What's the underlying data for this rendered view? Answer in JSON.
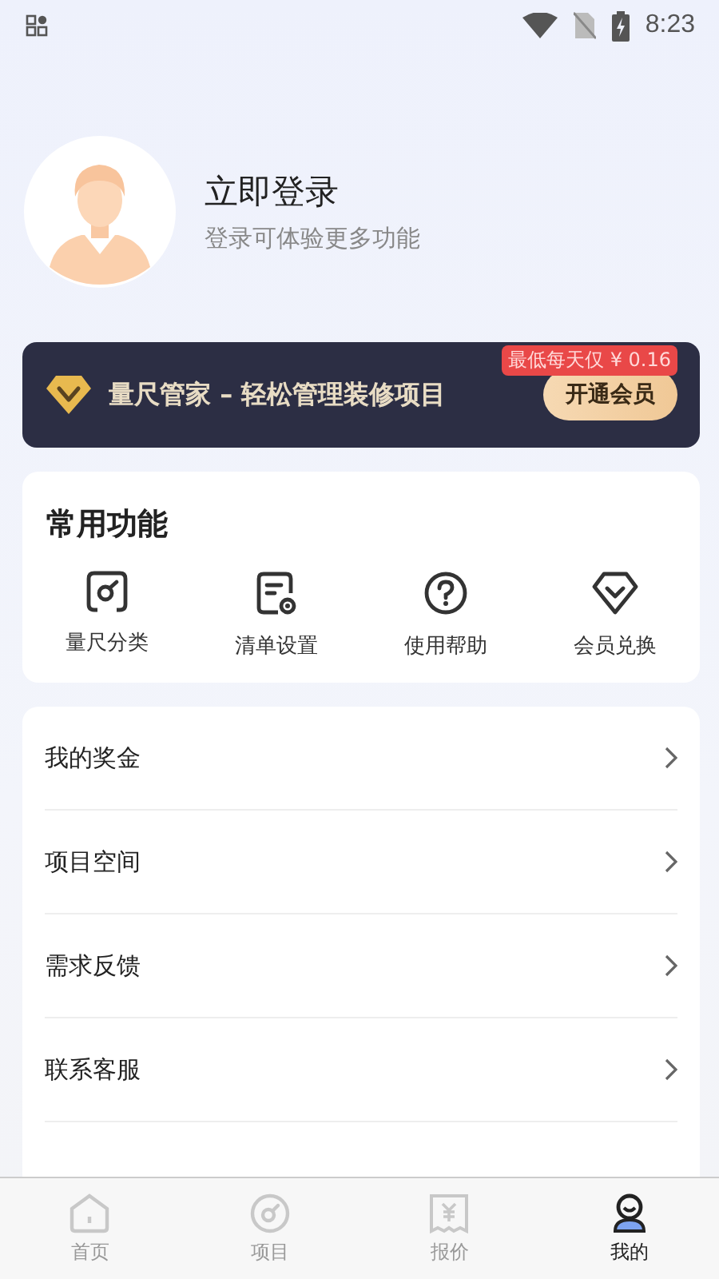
{
  "status_bar": {
    "time": "8:23"
  },
  "profile": {
    "title": "立即登录",
    "subtitle": "登录可体验更多功能"
  },
  "vip_banner": {
    "title": "量尺管家 – 轻松管理装修项目",
    "button": "开通会员",
    "badge": "最低每天仅 ¥ 0.16"
  },
  "common_functions": {
    "title": "常用功能",
    "items": [
      {
        "kind": "ruler",
        "label": "量尺分类"
      },
      {
        "kind": "list",
        "label": "清单设置"
      },
      {
        "kind": "help",
        "label": "使用帮助"
      },
      {
        "kind": "vip",
        "label": "会员兑换"
      }
    ]
  },
  "menu": [
    {
      "label": "我的奖金"
    },
    {
      "label": "项目空间"
    },
    {
      "label": "需求反馈"
    },
    {
      "label": "联系客服"
    }
  ],
  "tab_bar": [
    {
      "kind": "home",
      "label": "首页",
      "selected": false
    },
    {
      "kind": "project",
      "label": "项目",
      "selected": false
    },
    {
      "kind": "quote",
      "label": "报价",
      "selected": false
    },
    {
      "kind": "me",
      "label": "我的",
      "selected": true
    }
  ]
}
